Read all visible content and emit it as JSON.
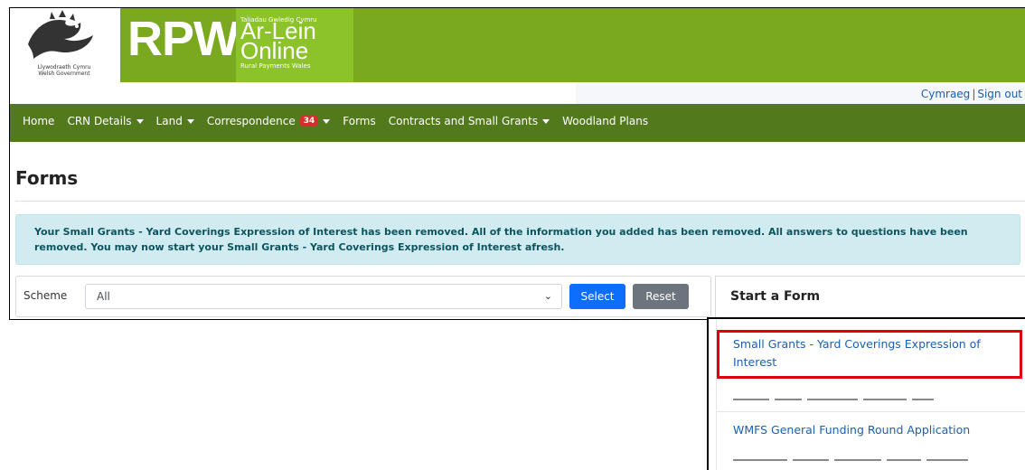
{
  "header": {
    "gov_text_line1": "Llywodraeth Cymru",
    "gov_text_line2": "Welsh Government",
    "rpw": "RPW",
    "online_small": "Taliadau Gwledig Cymru",
    "online_big1": "Ar-Lein",
    "online_big2": "Online",
    "online_sub": "Rural Payments Wales"
  },
  "top_links": {
    "cymraeg": "Cymraeg",
    "separator": "|",
    "sign_out": "Sign out"
  },
  "nav": {
    "home": "Home",
    "crn": "CRN Details",
    "land": "Land",
    "correspondence": "Correspondence",
    "correspondence_badge": "34",
    "forms": "Forms",
    "contracts": "Contracts and Small Grants",
    "woodland": "Woodland Plans"
  },
  "page": {
    "title": "Forms"
  },
  "alert": {
    "text": "Your Small Grants - Yard Coverings Expression of Interest has been removed. All of the information you added has been removed. All answers to questions have been removed. You may now start your Small Grants - Yard Coverings Expression of Interest afresh."
  },
  "filter": {
    "scheme_label": "Scheme",
    "scheme_value": "All",
    "select_button": "Select",
    "reset_button": "Reset"
  },
  "start_form": {
    "heading": "Start a Form",
    "items": [
      {
        "label": "Small Grants - Yard Coverings Expression of Interest"
      },
      {
        "label": "WMFS General Funding Round Application"
      }
    ]
  },
  "colors": {
    "rpw_green": "#7aa81e",
    "nav_green": "#527a1d",
    "badge_red": "#d82d2d",
    "alert_bg": "#d1ecf1",
    "primary_blue": "#0d6efd",
    "secondary_grey": "#6c757d",
    "highlight_red": "#e0000b"
  },
  "icons": [
    "dragon-logo-icon",
    "caret-down-icon",
    "chevron-down-icon"
  ]
}
